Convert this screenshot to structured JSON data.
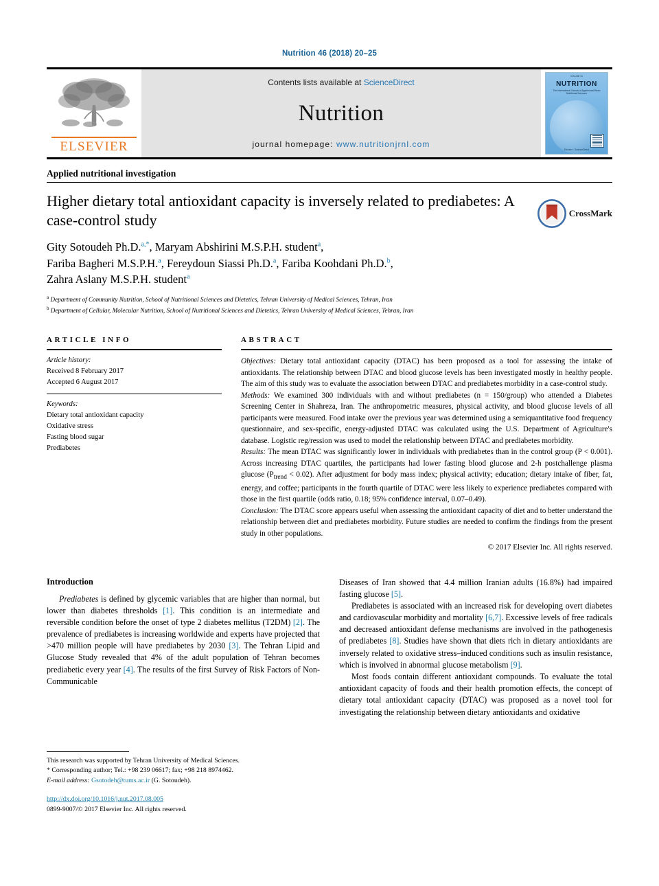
{
  "running_head": "Nutrition 46 (2018) 20–25",
  "masthead": {
    "publisher_name": "ELSEVIER",
    "contents_prefix": "Contents lists available at ",
    "contents_link": "ScienceDirect",
    "journal_name": "Nutrition",
    "homepage_prefix": "journal homepage: ",
    "homepage_url": "www.nutritionjrnl.com",
    "cover": {
      "volume_label": "VOLUME 31",
      "title": "NUTRITION",
      "subtitle": "The International Journal of Applied and Basic Nutritional Sciences",
      "footer": "Elsevier · ScienceDirect"
    }
  },
  "section_kind": "Applied nutritional investigation",
  "article": {
    "title": "Higher dietary total antioxidant capacity is inversely related to prediabetes: A case-control study",
    "authors_line_1": "Gity Sotoudeh Ph.D. a,*, Maryam Abshirini M.S.P.H. student a,",
    "authors_line_2": "Fariba Bagheri M.S.P.H. a, Fereydoun Siassi Ph.D. a, Fariba Koohdani Ph.D. b,",
    "authors_line_3": "Zahra Aslany M.S.P.H. student a",
    "affiliation_a": "Department of Community Nutrition, School of Nutritional Sciences and Dietetics, Tehran University of Medical Sciences, Tehran, Iran",
    "affiliation_b": "Department of Cellular, Molecular Nutrition, School of Nutritional Sciences and Dietetics, Tehran University of Medical Sciences, Tehran, Iran",
    "crossmark_label": "CrossMark"
  },
  "article_info": {
    "heading": "ARTICLE INFO",
    "history_label": "Article history:",
    "received": "Received 8 February 2017",
    "accepted": "Accepted 6 August 2017",
    "keywords_label": "Keywords:",
    "keywords": [
      "Dietary total antioxidant capacity",
      "Oxidative stress",
      "Fasting blood sugar",
      "Prediabetes"
    ]
  },
  "abstract": {
    "heading": "ABSTRACT",
    "objectives_label": "Objectives:",
    "objectives_text": " Dietary total antioxidant capacity (DTAC) has been proposed as a tool for assessing the intake of antioxidants. The relationship between DTAC and blood glucose levels has been investigated mostly in healthy people. The aim of this study was to evaluate the association between DTAC and prediabetes morbidity in a case-control study.",
    "methods_label": "Methods:",
    "methods_text": " We examined 300 individuals with and without prediabetes (n = 150/group) who attended a Diabetes Screening Center in Shahreza, Iran. The anthropometric measures, physical activity, and blood glucose levels of all participants were measured. Food intake over the previous year was determined using a semiquantitative food frequency questionnaire, and sex-specific, energy-adjusted DTAC was calculated using the U.S. Department of Agriculture's database. Logistic reg/ression was used to model the relationship between DTAC and prediabetes morbidity.",
    "results_label": "Results:",
    "results_text_1": " The mean DTAC was significantly lower in individuals with prediabetes than in the control group (P < 0.001). Across increasing DTAC quartiles, the participants had lower fasting blood glucose and 2-h postchallenge plasma glucose (P",
    "results_sub": "trend",
    "results_text_2": " < 0.02). After adjustment for body mass index; physical activity; education; dietary intake of fiber, fat, energy, and coffee; participants in the fourth quartile of DTAC were less likely to experience prediabetes compared with those in the first quartile (odds ratio, 0.18; 95% confidence interval, 0.07–0.49).",
    "conclusion_label": "Conclusion:",
    "conclusion_text": " The DTAC score appears useful when assessing the antioxidant capacity of diet and to better understand the relationship between diet and prediabetes morbidity. Future studies are needed to confirm the findings from the present study in other populations.",
    "copyright": "© 2017 Elsevier Inc. All rights reserved."
  },
  "body": {
    "intro_heading": "Introduction",
    "left_para_1_a": "Prediabetes",
    "left_para_1_b": " is defined by glycemic variables that are higher than normal, but lower than diabetes thresholds ",
    "left_para_1_r1": "[1]",
    "left_para_1_c": ". This condition is an intermediate and reversible condition before the onset of type 2 diabetes mellitus (T2DM) ",
    "left_para_1_r2": "[2]",
    "left_para_1_d": ". The prevalence of prediabetes is increasing worldwide and experts have projected that >470 million people will have prediabetes by 2030 ",
    "left_para_1_r3": "[3]",
    "left_para_1_e": ". The Tehran Lipid and Glucose Study revealed that 4% of the adult population of Tehran becomes prediabetic every year ",
    "left_para_1_r4": "[4]",
    "left_para_1_f": ". The results of the first Survey of Risk Factors of Non-Communicable",
    "right_para_1_a": "Diseases of Iran showed that 4.4 million Iranian adults (16.8%) had impaired fasting glucose ",
    "right_para_1_r5": "[5]",
    "right_para_1_b": ".",
    "right_para_2_a": "Prediabetes is associated with an increased risk for developing overt diabetes and cardiovascular morbidity and mortality ",
    "right_para_2_r67": "[6,7]",
    "right_para_2_b": ". Excessive levels of free radicals and decreased antioxidant defense mechanisms are involved in the pathogenesis of prediabetes ",
    "right_para_2_r8": "[8]",
    "right_para_2_c": ". Studies have shown that diets rich in dietary antioxidants are inversely related to oxidative stress–induced conditions such as insulin resistance, which is involved in abnormal glucose metabolism ",
    "right_para_2_r9": "[9]",
    "right_para_2_d": ".",
    "right_para_3": "Most foods contain different antioxidant compounds. To evaluate the total antioxidant capacity of foods and their health promotion effects, the concept of dietary total antioxidant capacity (DTAC) was proposed as a novel tool for investigating the relationship between dietary antioxidants and oxidative"
  },
  "footnotes": {
    "funding": "This research was supported by Tehran University of Medical Sciences.",
    "corresponding": "* Corresponding author; Tel.: +98 239 06617; fax; +98 218 8974462.",
    "email_label": "E-mail address:",
    "email": "Gsotodeh@tums.ac.ir",
    "email_suffix": " (G. Sotoudeh).",
    "doi": "http://dx.doi.org/10.1016/j.nut.2017.08.005",
    "issn_line": "0899-9007/© 2017 Elsevier Inc. All rights reserved."
  },
  "colors": {
    "link_blue": "#1a7aa8",
    "sciencedirect_blue": "#2878b5",
    "elsevier_orange": "#e87722",
    "band_gray": "#e3e3e3"
  }
}
